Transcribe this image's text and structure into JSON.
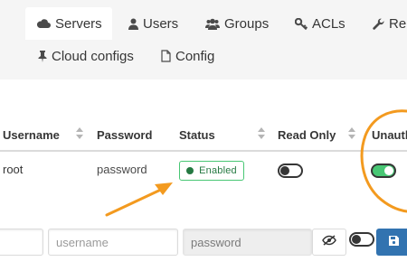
{
  "tabs": [
    {
      "label": "Servers",
      "icon": "cloud-icon",
      "active": true
    },
    {
      "label": "Users",
      "icon": "user-icon",
      "active": false
    },
    {
      "label": "Groups",
      "icon": "users-icon",
      "active": false
    },
    {
      "label": "ACLs",
      "icon": "key-icon",
      "active": false
    },
    {
      "label": "Re",
      "icon": "wrench-icon",
      "active": false
    }
  ],
  "tabs_row2": [
    {
      "label": "Cloud configs",
      "icon": "pin-icon"
    },
    {
      "label": "Config",
      "icon": "file-icon"
    }
  ],
  "table": {
    "headers": [
      "Username",
      "Password",
      "Status",
      "Read Only",
      "Unauth"
    ],
    "row": {
      "username": "root",
      "password": "password",
      "status": "Enabled",
      "read_only": false,
      "unauth": true
    }
  },
  "add_form": {
    "username_placeholder": "username",
    "password_placeholder": "password",
    "readonly_toggle": false
  },
  "colors": {
    "accent": "#3273b0",
    "success": "#48c774",
    "success_text": "#257942",
    "annotation": "#f39a1f",
    "tab_bar": "#f5f5f5"
  }
}
